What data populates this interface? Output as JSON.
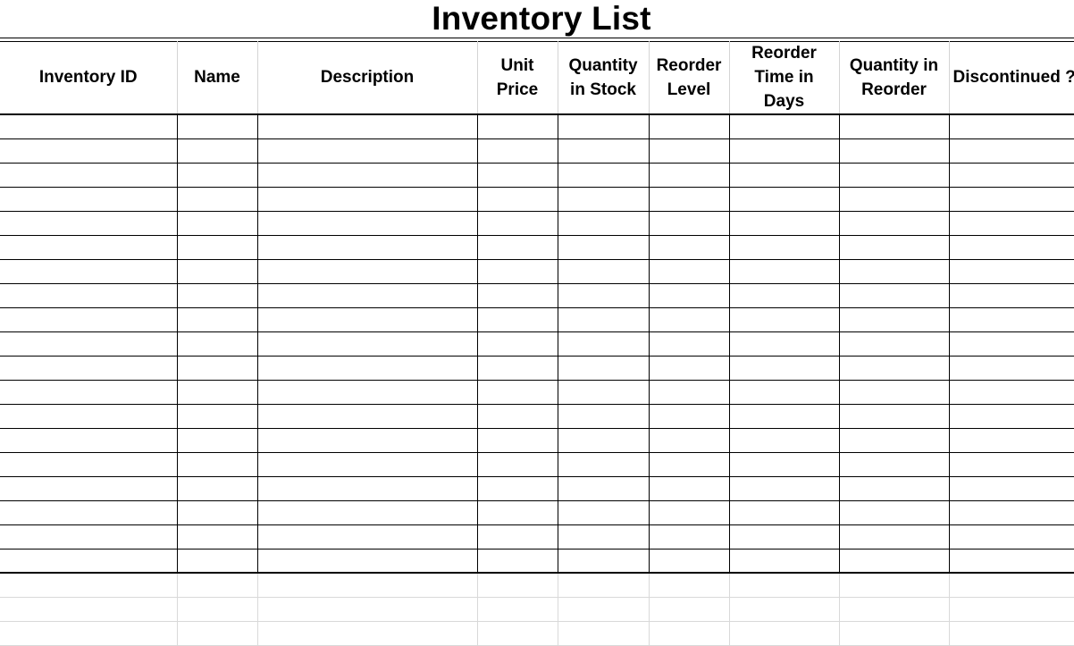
{
  "sheet": {
    "title": "Inventory List",
    "columns": [
      {
        "key": "inventory_id",
        "label": "Inventory ID"
      },
      {
        "key": "name",
        "label": "Name"
      },
      {
        "key": "description",
        "label": "Description"
      },
      {
        "key": "unit_price",
        "label": "Unit Price"
      },
      {
        "key": "quantity_in_stock",
        "label": "Quantity in Stock"
      },
      {
        "key": "reorder_level",
        "label": "Reorder Level"
      },
      {
        "key": "reorder_time_in_days",
        "label": "Reorder Time in Days"
      },
      {
        "key": "quantity_in_reorder",
        "label": "Quantity in Reorder"
      },
      {
        "key": "discontinued",
        "label": "Discontinued ?"
      }
    ],
    "bordered_row_count": 19,
    "empty_grid_row_count": 3,
    "rows": []
  }
}
